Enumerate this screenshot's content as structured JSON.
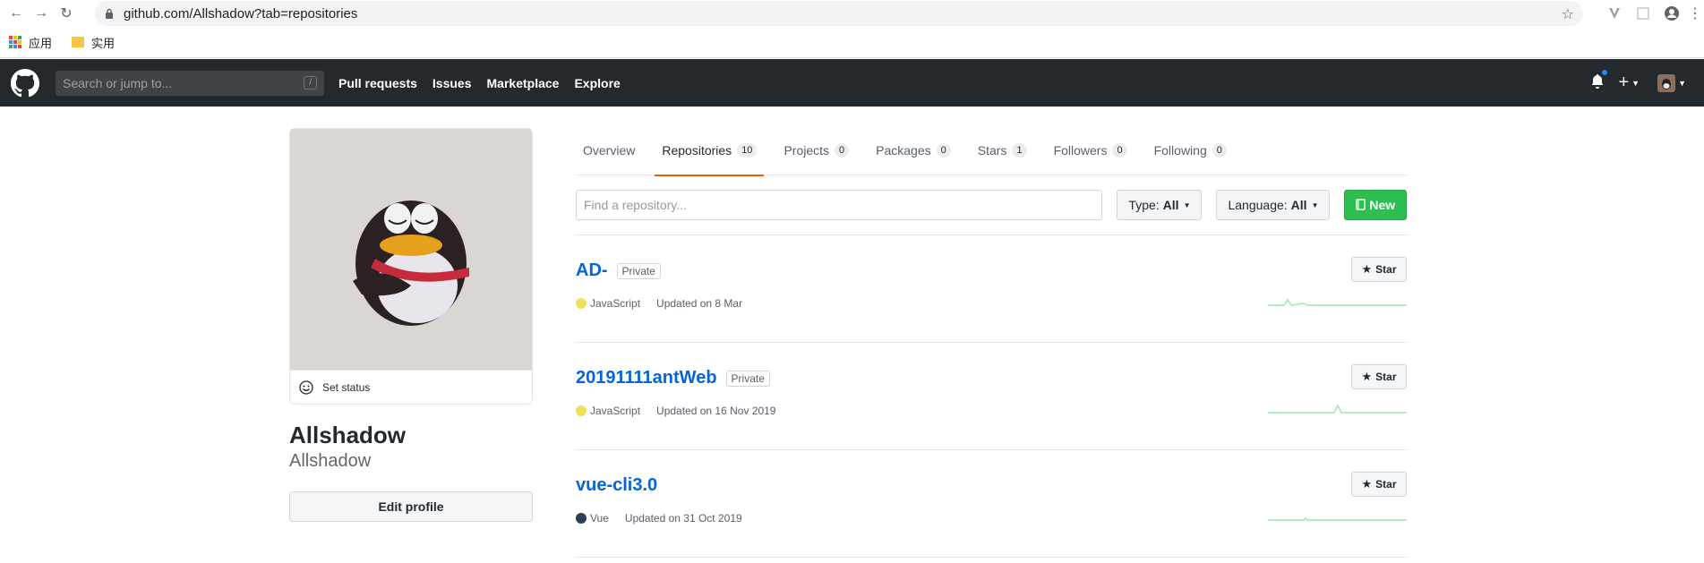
{
  "browser": {
    "url": "github.com/Allshadow?tab=repositories",
    "bookmarks": [
      {
        "label": "应用",
        "icon": "apps-grid-icon"
      },
      {
        "label": "实用",
        "icon": "folder-icon"
      }
    ]
  },
  "header": {
    "search_placeholder": "Search or jump to...",
    "search_key": "/",
    "nav": [
      "Pull requests",
      "Issues",
      "Marketplace",
      "Explore"
    ]
  },
  "profile": {
    "status_label": "Set status",
    "full_name": "Allshadow",
    "username": "Allshadow",
    "edit_button": "Edit profile"
  },
  "tabs": [
    {
      "label": "Overview",
      "count": null
    },
    {
      "label": "Repositories",
      "count": "10",
      "active": true
    },
    {
      "label": "Projects",
      "count": "0"
    },
    {
      "label": "Packages",
      "count": "0"
    },
    {
      "label": "Stars",
      "count": "1"
    },
    {
      "label": "Followers",
      "count": "0"
    },
    {
      "label": "Following",
      "count": "0"
    }
  ],
  "filters": {
    "find_placeholder": "Find a repository...",
    "type_label": "Type:",
    "type_value": "All",
    "language_label": "Language:",
    "language_value": "All",
    "new_button": "New"
  },
  "repos": [
    {
      "name": "AD-",
      "badge": "Private",
      "language": "JavaScript",
      "lang_color": "#f1e05a",
      "updated": "Updated on 8 Mar",
      "star_label": "Star"
    },
    {
      "name": "20191111antWeb",
      "badge": "Private",
      "language": "JavaScript",
      "lang_color": "#f1e05a",
      "updated": "Updated on 16 Nov 2019",
      "star_label": "Star"
    },
    {
      "name": "vue-cli3.0",
      "badge": "",
      "language": "Vue",
      "lang_color": "#2c3e50",
      "updated": "Updated on 31 Oct 2019",
      "star_label": "Star"
    }
  ],
  "colors": {
    "header_bg": "#24292e",
    "link": "#0366d6",
    "active_tab": "#e36209",
    "new_button": "#2cbe4e"
  }
}
